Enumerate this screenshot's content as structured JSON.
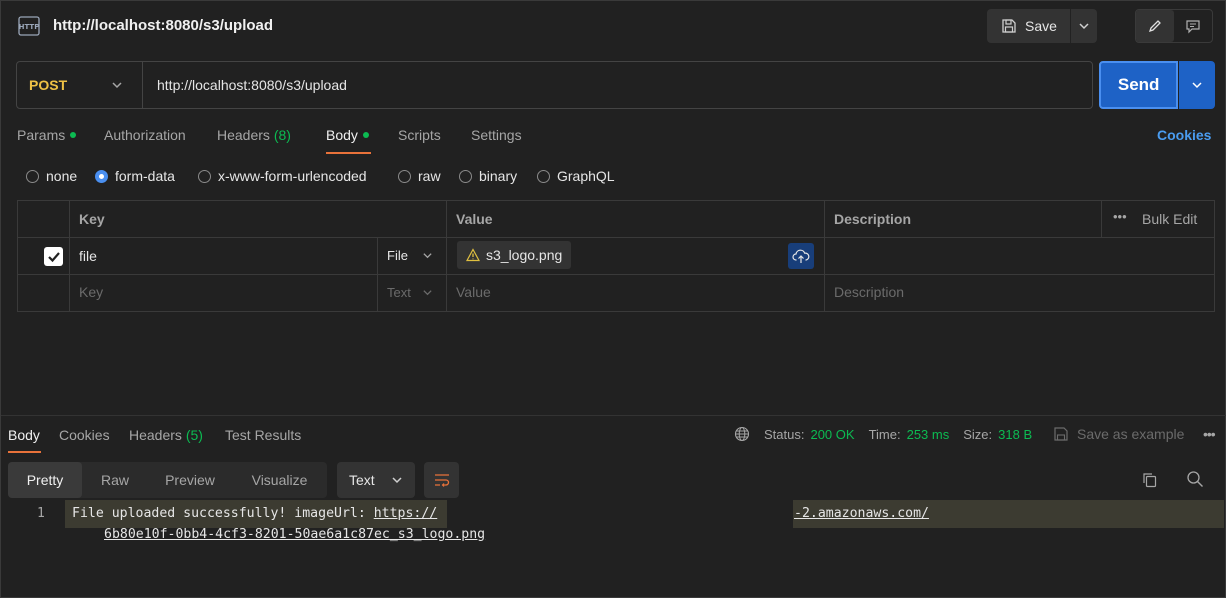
{
  "header": {
    "title": "http://localhost:8080/s3/upload",
    "save_label": "Save"
  },
  "request": {
    "method": "POST",
    "url": "http://localhost:8080/s3/upload",
    "send_label": "Send"
  },
  "tabs": {
    "params": "Params",
    "authorization": "Authorization",
    "headers": "Headers",
    "headers_count": "(8)",
    "body": "Body",
    "scripts": "Scripts",
    "settings": "Settings",
    "cookies": "Cookies"
  },
  "body_types": [
    "none",
    "form-data",
    "x-www-form-urlencoded",
    "raw",
    "binary",
    "GraphQL"
  ],
  "selected_body_type": "form-data",
  "params_table": {
    "headers": {
      "key": "Key",
      "value": "Value",
      "description": "Description",
      "bulk_edit": "Bulk Edit"
    },
    "row1": {
      "key": "file",
      "type": "File",
      "value": "s3_logo.png"
    },
    "placeholder": {
      "key": "Key",
      "type": "Text",
      "value": "Value",
      "description": "Description"
    }
  },
  "response": {
    "tabs": {
      "body": "Body",
      "cookies": "Cookies",
      "headers": "Headers",
      "headers_count": "(5)",
      "test_results": "Test Results"
    },
    "status_label": "Status:",
    "status_value": "200 OK",
    "time_label": "Time:",
    "time_value": "253 ms",
    "size_label": "Size:",
    "size_value": "318 B",
    "save_example": "Save as example",
    "views": [
      "Pretty",
      "Raw",
      "Preview",
      "Visualize"
    ],
    "format": "Text",
    "line_number": "1",
    "line_text": "File uploaded successfully! imageUrl: ",
    "url_part1": "https://",
    "url_part2": "-2.amazonaws.com/",
    "url_part3": "6b80e10f-0bb4-4cf3-8201-50ae6a1c87ec_s3_logo.png"
  }
}
